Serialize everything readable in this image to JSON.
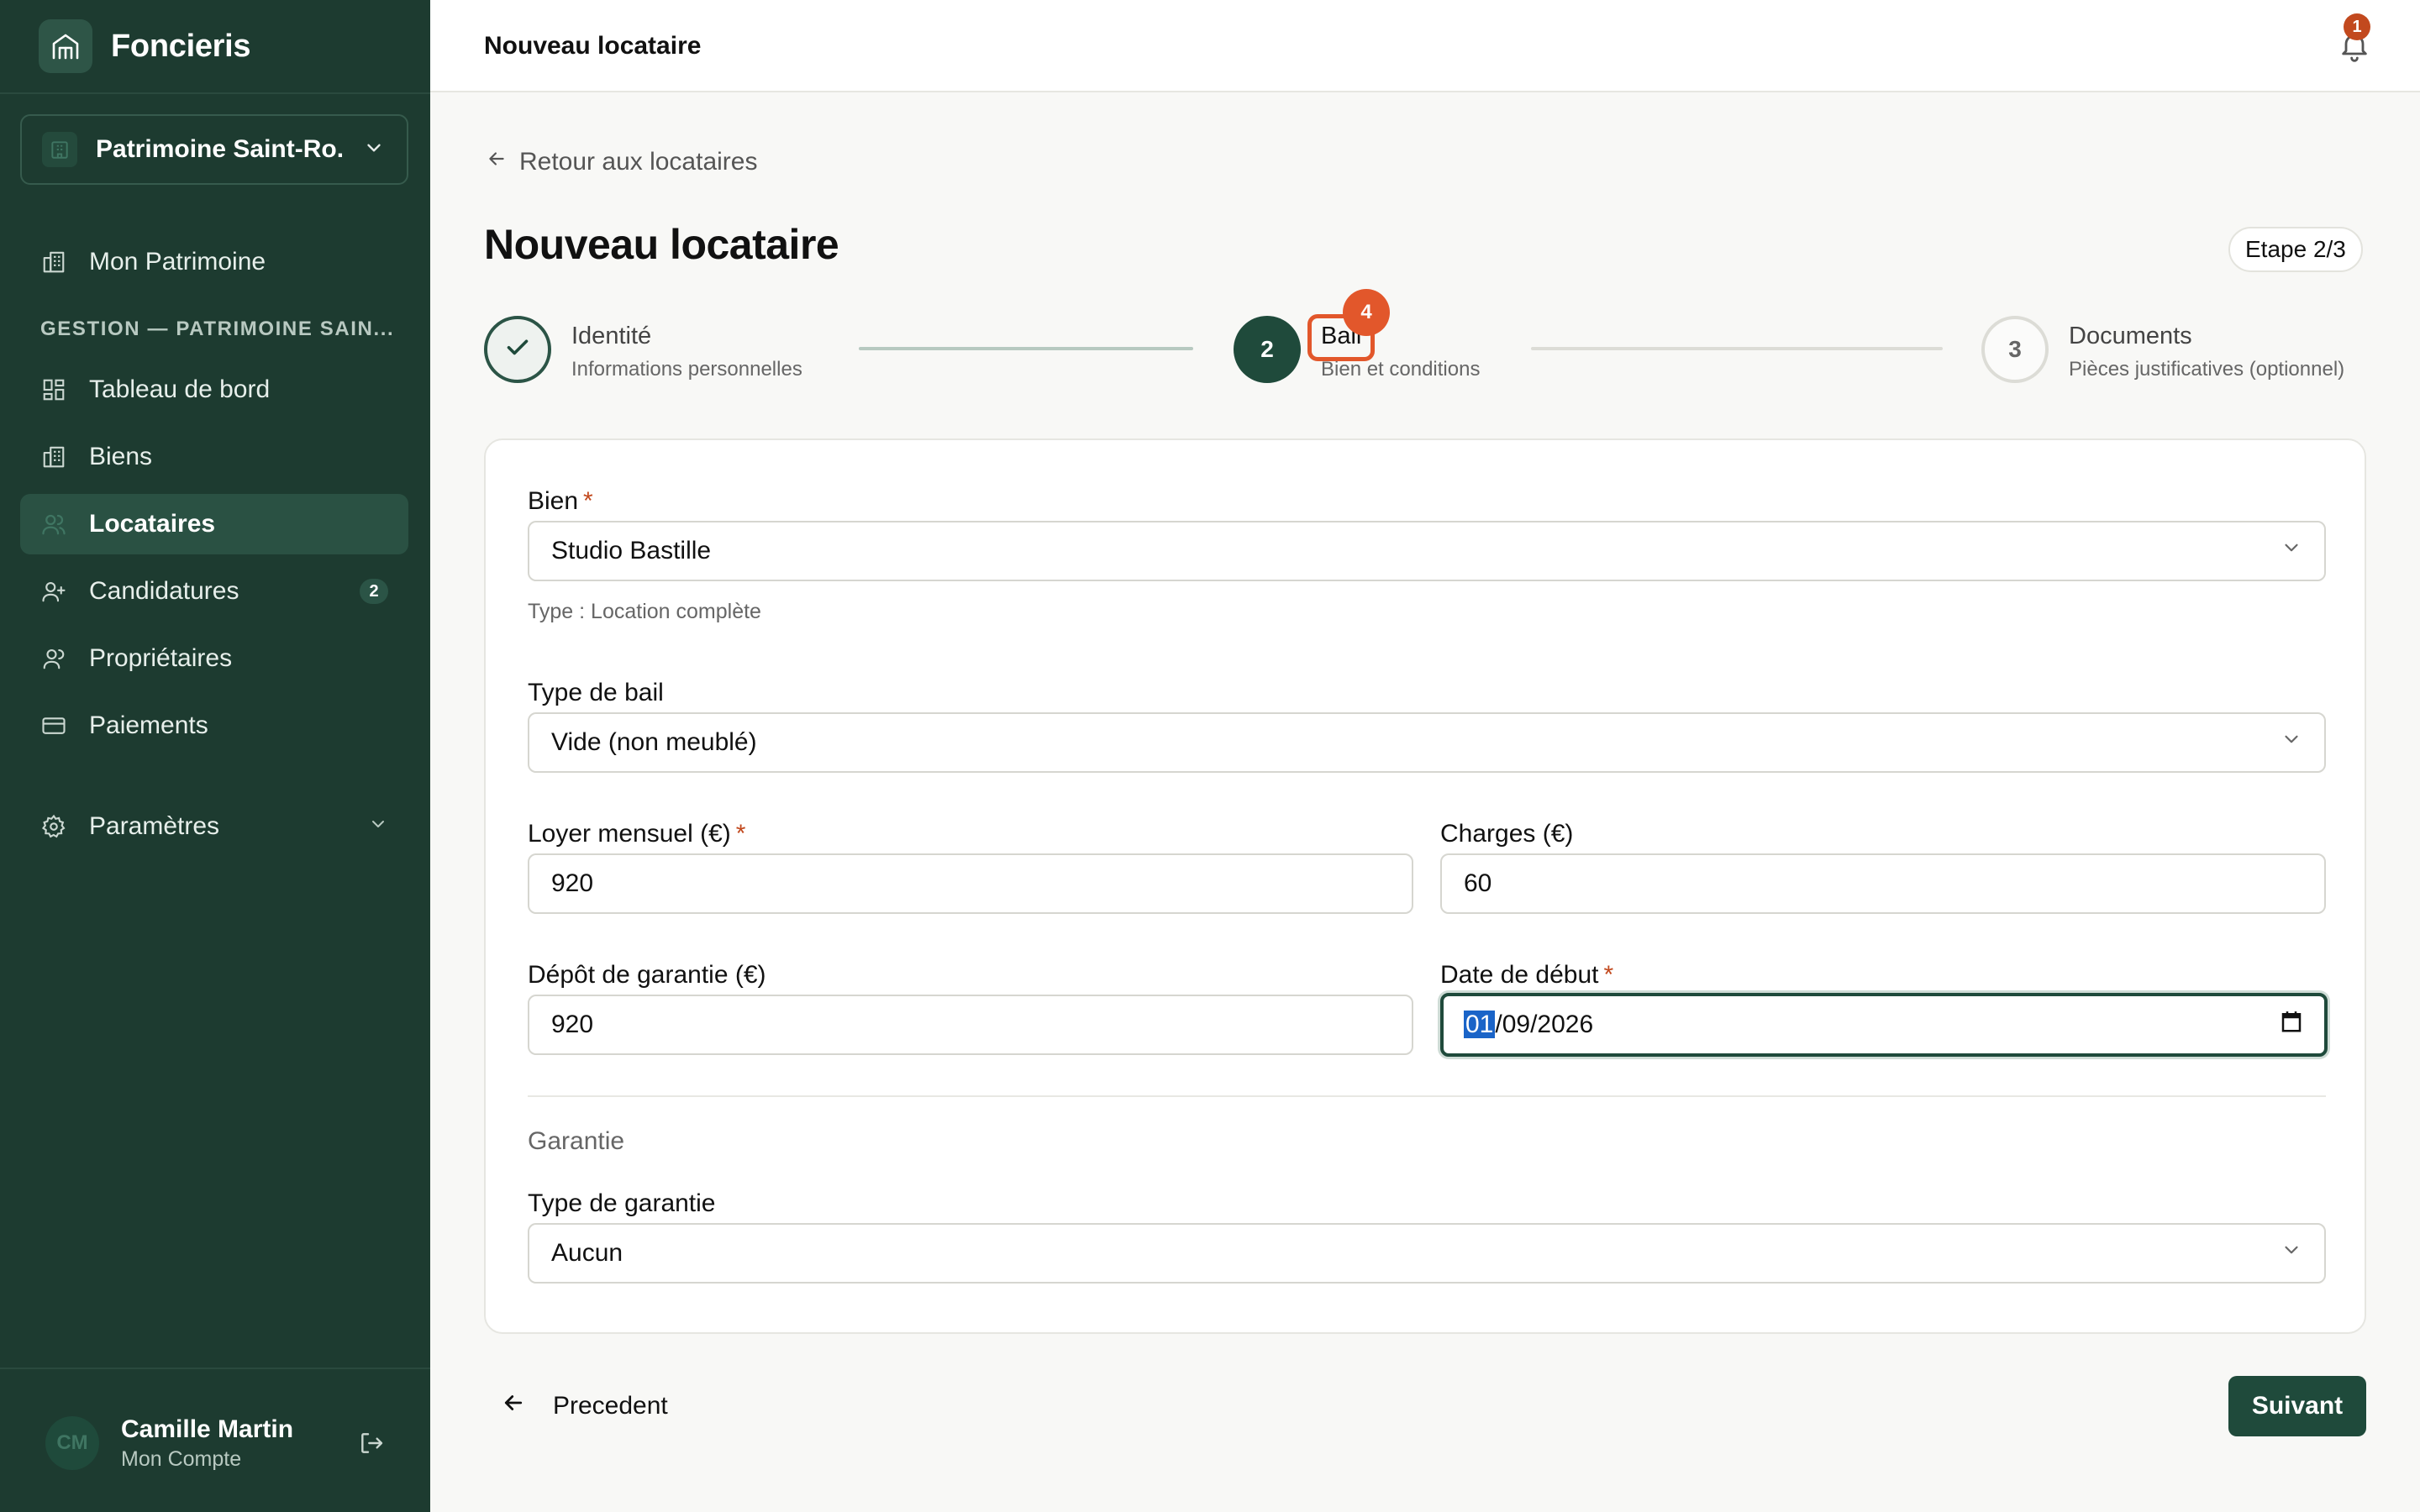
{
  "brand": {
    "name": "Foncieris"
  },
  "org_switcher": {
    "name": "Patrimoine Saint-Ro..."
  },
  "sidebar": {
    "top_item": {
      "label": "Mon Patrimoine",
      "icon": "building-icon"
    },
    "section_title": "GESTION — PATRIMOINE SAIN...",
    "items": [
      {
        "label": "Tableau de bord",
        "icon": "dashboard-icon"
      },
      {
        "label": "Biens",
        "icon": "building-icon"
      },
      {
        "label": "Locataires",
        "icon": "users-icon",
        "active": true
      },
      {
        "label": "Candidatures",
        "icon": "user-plus-icon",
        "badge": "2"
      },
      {
        "label": "Propriétaires",
        "icon": "owners-icon"
      },
      {
        "label": "Paiements",
        "icon": "credit-card-icon"
      }
    ],
    "settings": {
      "label": "Paramètres",
      "icon": "gear-icon"
    }
  },
  "user": {
    "initials": "CM",
    "name": "Camille Martin",
    "subtitle": "Mon Compte"
  },
  "header": {
    "title": "Nouveau locataire",
    "notifications_count": "1"
  },
  "main": {
    "back_link": "Retour aux locataires",
    "title": "Nouveau locataire",
    "step_indicator": "Etape 2/3"
  },
  "stepper": {
    "steps": [
      {
        "number": "1",
        "title": "Identité",
        "subtitle": "Informations personnelles",
        "state": "complete"
      },
      {
        "number": "2",
        "title": "Bail",
        "subtitle": "Bien et conditions",
        "state": "current"
      },
      {
        "number": "3",
        "title": "Documents",
        "subtitle": "Pièces justificatives (optionnel)",
        "state": "upcoming"
      }
    ],
    "highlight_marker": "4"
  },
  "form": {
    "bien": {
      "label": "Bien",
      "required_mark": "*",
      "value": "Studio Bastille",
      "hint": "Type : Location complète"
    },
    "type_bail": {
      "label": "Type de bail",
      "value": "Vide (non meublé)"
    },
    "loyer": {
      "label": "Loyer mensuel (€)",
      "required_mark": "*",
      "value": "920"
    },
    "charges": {
      "label": "Charges (€)",
      "value": "60"
    },
    "depot": {
      "label": "Dépôt de garantie (€)",
      "value": "920"
    },
    "date_debut": {
      "label": "Date de début",
      "required_mark": "*",
      "value_day": "01",
      "value_rest": "/09/2026"
    },
    "garantie_section": "Garantie",
    "type_garantie": {
      "label": "Type de garantie",
      "value": "Aucun"
    }
  },
  "actions": {
    "previous": "Precedent",
    "next": "Suivant"
  },
  "colors": {
    "sidebar_bg": "#1d3b30",
    "primary": "#1f4a3b",
    "accent": "#c2491e",
    "highlight": "#e2572b"
  }
}
